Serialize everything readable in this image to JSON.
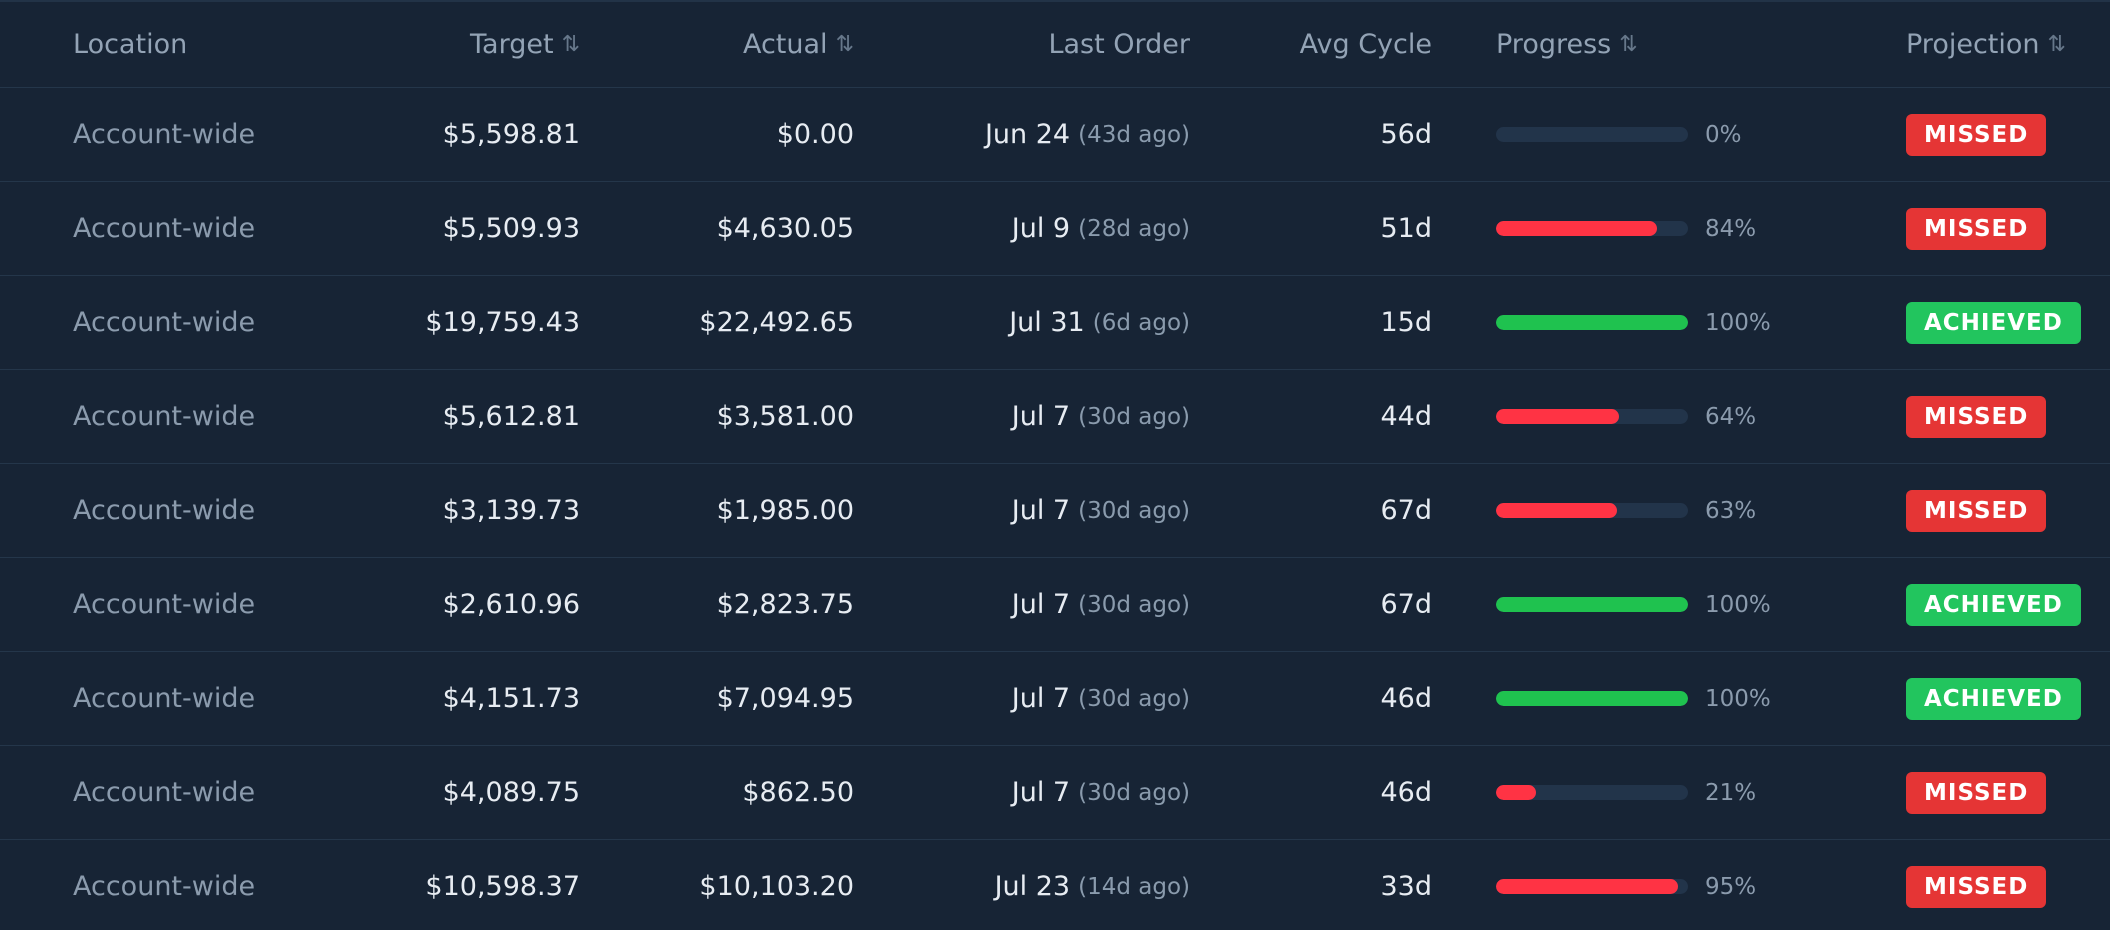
{
  "columns": {
    "location": "Location",
    "target": "Target",
    "actual": "Actual",
    "last_order": "Last Order",
    "avg_cycle": "Avg Cycle",
    "progress": "Progress",
    "projection": "Projection"
  },
  "sort_icon": "⇅",
  "colors": {
    "missed": "#e53535",
    "achieved": "#22c55e",
    "bar_red": "#ff3344",
    "bar_green": "#1fc24f"
  },
  "rows": [
    {
      "location": "Account-wide",
      "target": "$5,598.81",
      "actual": "$0.00",
      "last_order": "Jun 24",
      "ago": "(43d ago)",
      "avg_cycle": "56d",
      "progress": 0,
      "progress_label": "0%",
      "projection": "MISSED",
      "status": "missed"
    },
    {
      "location": "Account-wide",
      "target": "$5,509.93",
      "actual": "$4,630.05",
      "last_order": "Jul 9",
      "ago": "(28d ago)",
      "avg_cycle": "51d",
      "progress": 84,
      "progress_label": "84%",
      "projection": "MISSED",
      "status": "missed"
    },
    {
      "location": "Account-wide",
      "target": "$19,759.43",
      "actual": "$22,492.65",
      "last_order": "Jul 31",
      "ago": "(6d ago)",
      "avg_cycle": "15d",
      "progress": 100,
      "progress_label": "100%",
      "projection": "ACHIEVED",
      "status": "achieved"
    },
    {
      "location": "Account-wide",
      "target": "$5,612.81",
      "actual": "$3,581.00",
      "last_order": "Jul 7",
      "ago": "(30d ago)",
      "avg_cycle": "44d",
      "progress": 64,
      "progress_label": "64%",
      "projection": "MISSED",
      "status": "missed"
    },
    {
      "location": "Account-wide",
      "target": "$3,139.73",
      "actual": "$1,985.00",
      "last_order": "Jul 7",
      "ago": "(30d ago)",
      "avg_cycle": "67d",
      "progress": 63,
      "progress_label": "63%",
      "projection": "MISSED",
      "status": "missed"
    },
    {
      "location": "Account-wide",
      "target": "$2,610.96",
      "actual": "$2,823.75",
      "last_order": "Jul 7",
      "ago": "(30d ago)",
      "avg_cycle": "67d",
      "progress": 100,
      "progress_label": "100%",
      "projection": "ACHIEVED",
      "status": "achieved"
    },
    {
      "location": "Account-wide",
      "target": "$4,151.73",
      "actual": "$7,094.95",
      "last_order": "Jul 7",
      "ago": "(30d ago)",
      "avg_cycle": "46d",
      "progress": 100,
      "progress_label": "100%",
      "projection": "ACHIEVED",
      "status": "achieved"
    },
    {
      "location": "Account-wide",
      "target": "$4,089.75",
      "actual": "$862.50",
      "last_order": "Jul 7",
      "ago": "(30d ago)",
      "avg_cycle": "46d",
      "progress": 21,
      "progress_label": "21%",
      "projection": "MISSED",
      "status": "missed"
    },
    {
      "location": "Account-wide",
      "target": "$10,598.37",
      "actual": "$10,103.20",
      "last_order": "Jul 23",
      "ago": "(14d ago)",
      "avg_cycle": "33d",
      "progress": 95,
      "progress_label": "95%",
      "projection": "MISSED",
      "status": "missed"
    }
  ]
}
